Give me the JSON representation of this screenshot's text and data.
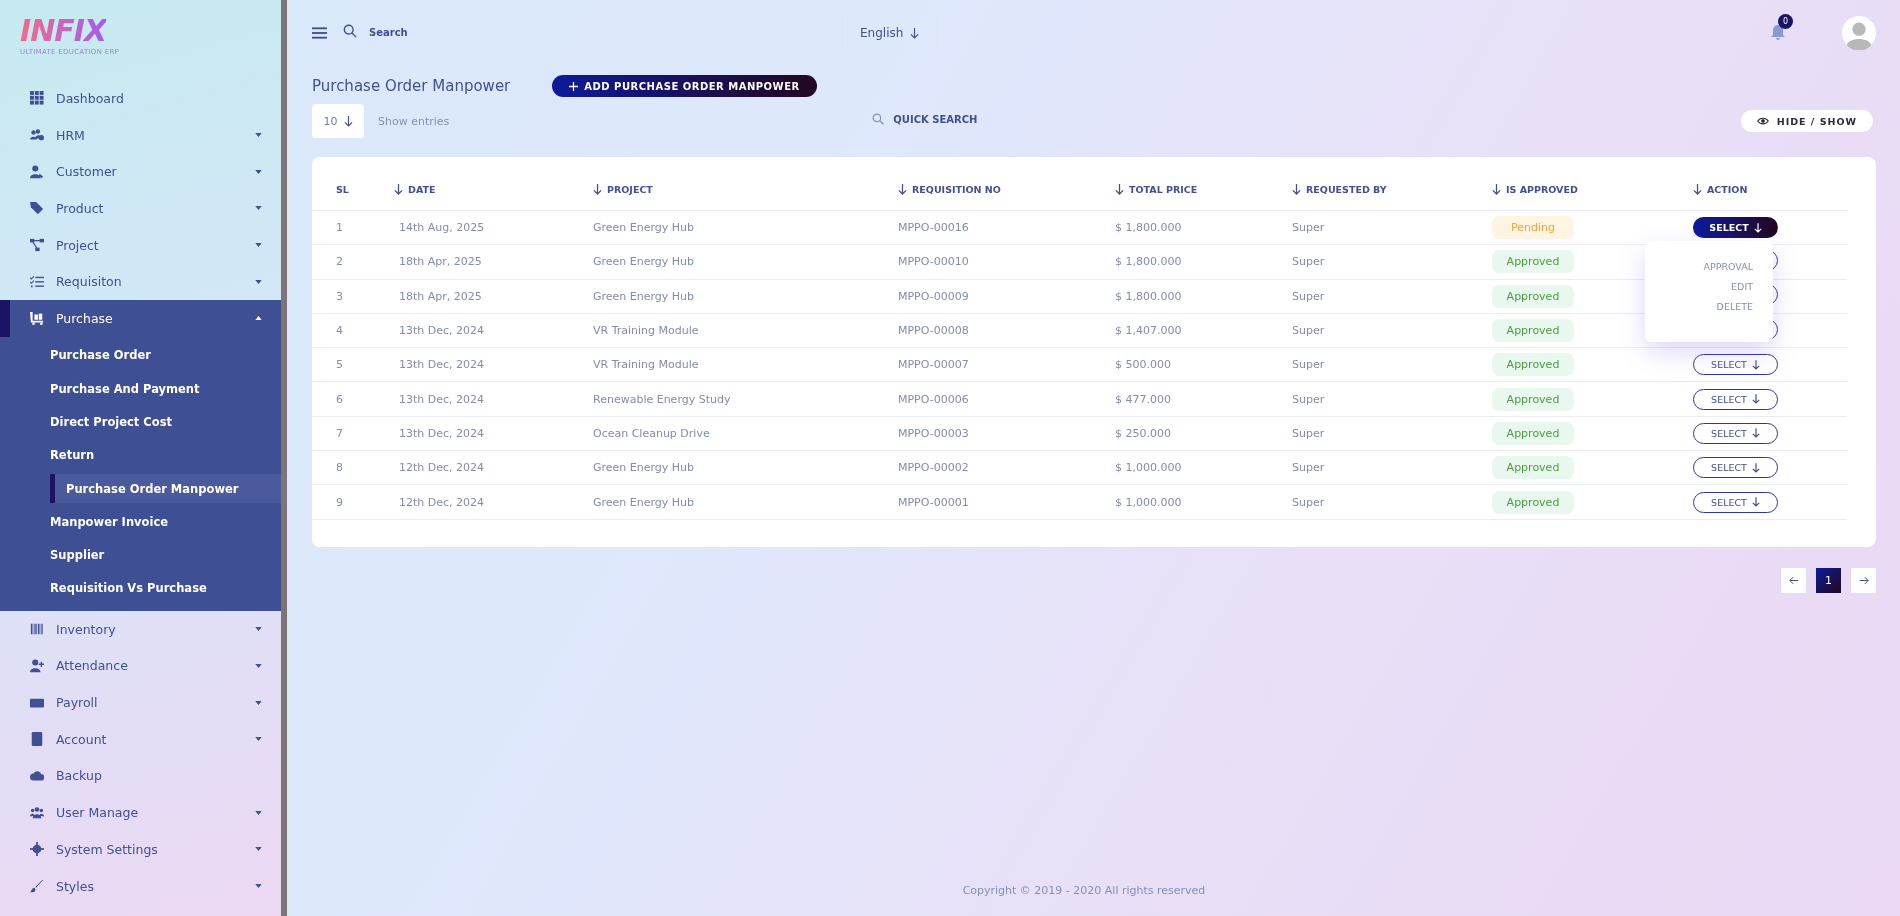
{
  "logo": {
    "title": "INFIX",
    "subtitle": "ULTIMATE EDUCATION ERP"
  },
  "sidebar": {
    "items": [
      {
        "label": "Dashboard"
      },
      {
        "label": "HRM",
        "expanded": false
      },
      {
        "label": "Customer",
        "expanded": false
      },
      {
        "label": "Product",
        "expanded": false
      },
      {
        "label": "Project",
        "expanded": false
      },
      {
        "label": "Requisiton",
        "expanded": false
      },
      {
        "label": "Purchase",
        "expanded": true,
        "children": [
          {
            "label": "Purchase Order",
            "selected": false
          },
          {
            "label": "Purchase And Payment",
            "selected": false
          },
          {
            "label": "Direct Project Cost",
            "selected": false
          },
          {
            "label": "Return",
            "selected": false
          },
          {
            "label": "Purchase Order Manpower",
            "selected": true
          },
          {
            "label": "Manpower Invoice",
            "selected": false
          },
          {
            "label": "Supplier",
            "selected": false
          },
          {
            "label": "Requisition Vs Purchase",
            "selected": false
          }
        ]
      },
      {
        "label": "Inventory",
        "expanded": false
      },
      {
        "label": "Attendance",
        "expanded": false
      },
      {
        "label": "Payroll",
        "expanded": false
      },
      {
        "label": "Account",
        "expanded": false
      },
      {
        "label": "Backup"
      },
      {
        "label": "User Manage",
        "expanded": false
      },
      {
        "label": "System Settings",
        "expanded": false
      },
      {
        "label": "Styles",
        "expanded": false
      }
    ]
  },
  "topbar": {
    "search": {
      "placeholder": "Search"
    },
    "language": "English",
    "notifications": "0"
  },
  "page": {
    "title": "Purchase Order Manpower",
    "add_button": "ADD PURCHASE ORDER MANPOWER",
    "entries": "10",
    "entries_label": "Show entries",
    "quick_search": {
      "placeholder": "QUICK SEARCH"
    },
    "hide_show": "HIDE / SHOW"
  },
  "table": {
    "columns": [
      {
        "label": "SL",
        "sortable": false
      },
      {
        "label": "DATE",
        "sortable": true
      },
      {
        "label": "PROJECT",
        "sortable": true
      },
      {
        "label": "REQUISITION NO",
        "sortable": true
      },
      {
        "label": "TOTAL PRICE",
        "sortable": true
      },
      {
        "label": "REQUESTED BY",
        "sortable": true
      },
      {
        "label": "IS APPROVED",
        "sortable": true
      },
      {
        "label": "ACTION",
        "sortable": true
      }
    ],
    "rows": [
      {
        "sl": "1",
        "date": "14th Aug, 2025",
        "project": "Green Energy Hub",
        "requisition": "MPPO-00016",
        "total": "$ 1,800.000",
        "requested_by": "Super",
        "status": {
          "text": "Pending",
          "kind": "pending"
        },
        "action": {
          "label": "SELECT",
          "open": true
        }
      },
      {
        "sl": "2",
        "date": "18th Apr, 2025",
        "project": "Green Energy Hub",
        "requisition": "MPPO-00010",
        "total": "$ 1,800.000",
        "requested_by": "Super",
        "status": {
          "text": "Approved",
          "kind": "approved"
        }
      },
      {
        "sl": "3",
        "date": "18th Apr, 2025",
        "project": "Green Energy Hub",
        "requisition": "MPPO-00009",
        "total": "$ 1,800.000",
        "requested_by": "Super",
        "status": {
          "text": "Approved",
          "kind": "approved"
        }
      },
      {
        "sl": "4",
        "date": "13th Dec, 2024",
        "project": "VR Training Module",
        "requisition": "MPPO-00008",
        "total": "$ 1,407.000",
        "requested_by": "Super",
        "status": {
          "text": "Approved",
          "kind": "approved"
        }
      },
      {
        "sl": "5",
        "date": "13th Dec, 2024",
        "project": "VR Training Module",
        "requisition": "MPPO-00007",
        "total": "$ 500.000",
        "requested_by": "Super",
        "status": {
          "text": "Approved",
          "kind": "approved"
        },
        "action": {
          "label": "SELECT",
          "open": false
        }
      },
      {
        "sl": "6",
        "date": "13th Dec, 2024",
        "project": "Renewable Energy Study",
        "requisition": "MPPO-00006",
        "total": "$ 477.000",
        "requested_by": "Super",
        "status": {
          "text": "Approved",
          "kind": "approved"
        },
        "action": {
          "label": "SELECT",
          "open": false
        }
      },
      {
        "sl": "7",
        "date": "13th Dec, 2024",
        "project": "Ocean Cleanup Drive",
        "requisition": "MPPO-00003",
        "total": "$ 250.000",
        "requested_by": "Super",
        "status": {
          "text": "Approved",
          "kind": "approved"
        },
        "action": {
          "label": "SELECT",
          "open": false
        }
      },
      {
        "sl": "8",
        "date": "12th Dec, 2024",
        "project": "Green Energy Hub",
        "requisition": "MPPO-00002",
        "total": "$ 1,000.000",
        "requested_by": "Super",
        "status": {
          "text": "Approved",
          "kind": "approved"
        },
        "action": {
          "label": "SELECT",
          "open": false
        }
      },
      {
        "sl": "9",
        "date": "12th Dec, 2024",
        "project": "Green Energy Hub",
        "requisition": "MPPO-00001",
        "total": "$ 1,000.000",
        "requested_by": "Super",
        "status": {
          "text": "Approved",
          "kind": "approved"
        },
        "action": {
          "label": "SELECT",
          "open": false
        }
      }
    ],
    "action_menu": [
      "APPROVAL",
      "EDIT",
      "DELETE"
    ]
  },
  "pagination": {
    "pages": [
      {
        "label": "1",
        "selected": true
      }
    ]
  },
  "footer": "Copyright © 2019 - 2020 All rights reserved"
}
